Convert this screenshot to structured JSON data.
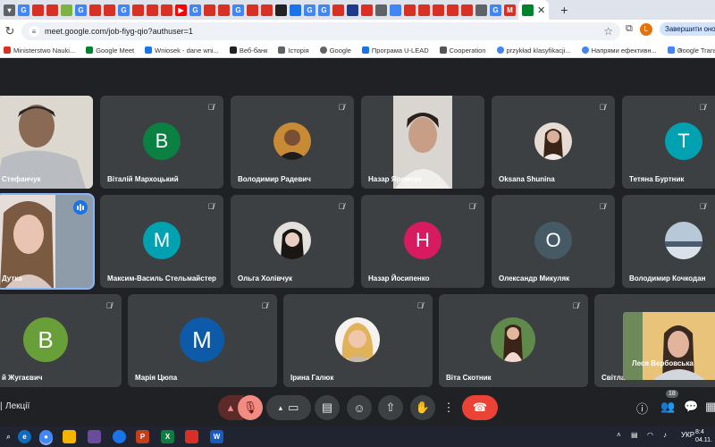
{
  "browser": {
    "url": "meet.google.com/job-fiyg-qio?authuser=1",
    "complete_label": "Завершити онов",
    "profile_initial": "L",
    "bookmarks": [
      {
        "label": "Ministerstwo Nauki...",
        "color": "#d93025"
      },
      {
        "label": "Google Meet",
        "color": "#00832d"
      },
      {
        "label": "Wniosek - dane wni...",
        "color": "#1a73e8"
      },
      {
        "label": "Веб-банк",
        "color": "#222222"
      },
      {
        "label": "Історія",
        "color": "#5f6368"
      },
      {
        "label": "Google",
        "color": "#5f6368"
      },
      {
        "label": "Програма U-LEAD",
        "color": "#1a73e8"
      },
      {
        "label": "Cooperation",
        "color": "#555555"
      },
      {
        "label": "przykład klasyfikacji...",
        "color": "#4285f4"
      },
      {
        "label": "Напрями ефективн...",
        "color": "#4285f4"
      },
      {
        "label": "Google Translate",
        "color": "#4285f4"
      }
    ]
  },
  "meet": {
    "meeting_name": "Лекції",
    "participant_count": "18",
    "tiles": [
      {
        "name": "Стефанчук"
      },
      {
        "name": "Віталій Мархоцький",
        "initial": "B",
        "color": "#0b8043"
      },
      {
        "name": "Володимир Радевич"
      },
      {
        "name": "Назар Яремчук"
      },
      {
        "name": "Oksana Shunina"
      },
      {
        "name": "Тетяна Буртник",
        "initial": "T",
        "color": "#00a1b0"
      },
      {
        "name": "Дутка"
      },
      {
        "name": "Максим-Василь Стельмайстер",
        "initial": "M",
        "color": "#00a1b0"
      },
      {
        "name": "Ольга Холівчук"
      },
      {
        "name": "Назар Йосипенко",
        "initial": "H",
        "color": "#d81b60"
      },
      {
        "name": "Олександр Микуляк",
        "initial": "O",
        "color": "#455a64"
      },
      {
        "name": "Володимир Кочкодан"
      },
      {
        "name": "й Жугаєвич",
        "initial": "B",
        "color": "#689f38"
      },
      {
        "name": "Марія Цюпа",
        "initial": "M",
        "color": "#0d5ba8"
      },
      {
        "name": "Ірина Галюк"
      },
      {
        "name": "Віта Скотник"
      },
      {
        "name": "Світла"
      },
      {
        "name": "Леся Вербовська"
      }
    ]
  },
  "taskbar": {
    "lang": "УКР",
    "time": "8:4",
    "date": "04.11."
  }
}
